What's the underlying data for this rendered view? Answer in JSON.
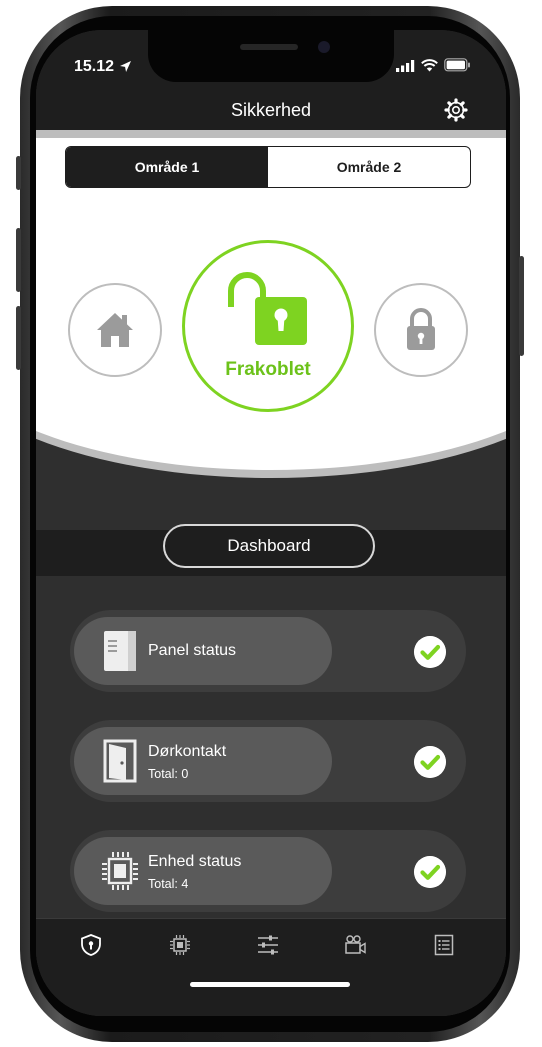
{
  "status_bar": {
    "time": "15.12"
  },
  "header": {
    "title": "Sikkerhed"
  },
  "area_tabs": [
    {
      "label": "Område 1",
      "selected": true
    },
    {
      "label": "Område 2",
      "selected": false
    }
  ],
  "arm_modes": {
    "left": {
      "icon": "home-icon"
    },
    "center": {
      "icon": "unlocked-padlock-icon",
      "label": "Frakoblet"
    },
    "right": {
      "icon": "padlock-icon"
    }
  },
  "dashboard_label": "Dashboard",
  "status_cards": [
    {
      "icon": "panel-icon",
      "title": "Panel status",
      "subtitle": "",
      "ok": true
    },
    {
      "icon": "door-icon",
      "title": "Dørkontakt",
      "subtitle": "Total: 0",
      "ok": true
    },
    {
      "icon": "chip-icon",
      "title": "Enhed status",
      "subtitle": "Total: 4",
      "ok": true
    }
  ],
  "tab_bar": [
    {
      "icon": "shield-icon",
      "active": true
    },
    {
      "icon": "chip-icon"
    },
    {
      "icon": "sliders-icon"
    },
    {
      "icon": "video-camera-icon"
    },
    {
      "icon": "list-icon"
    }
  ],
  "colors": {
    "accent_green": "#7ed321",
    "label_green": "#6cc21a",
    "header_bg": "#1e1e1e",
    "screen_bg": "#2f2f2f"
  }
}
